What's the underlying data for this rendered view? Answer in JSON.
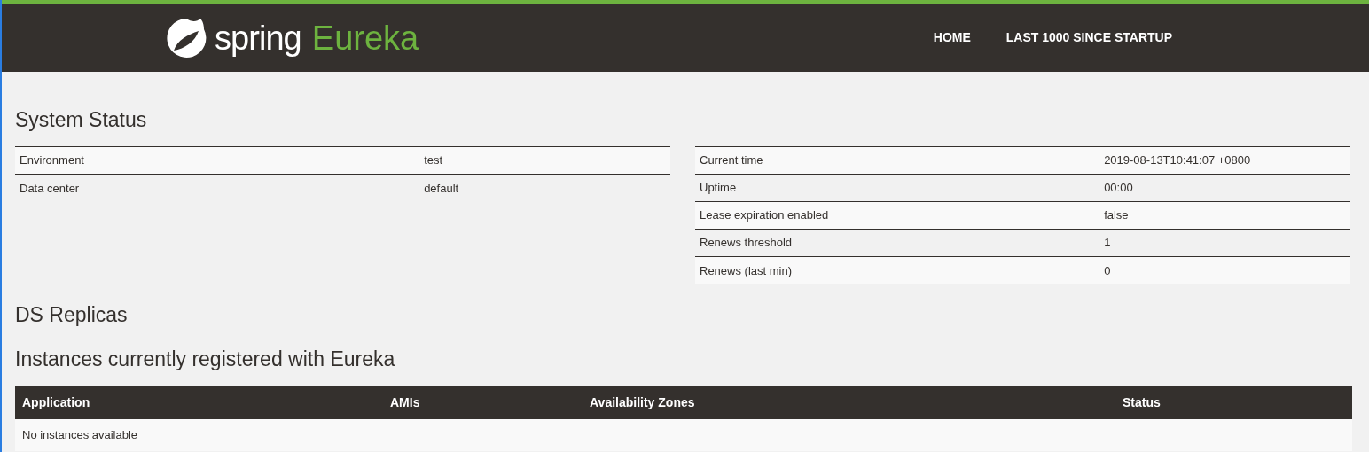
{
  "header": {
    "logo": {
      "word": "spring",
      "product": "Eureka"
    },
    "nav": [
      {
        "label": "HOME"
      },
      {
        "label": "LAST 1000 SINCE STARTUP"
      }
    ]
  },
  "system_status": {
    "title": "System Status",
    "left_table": [
      {
        "name": "Environment",
        "value": "test"
      },
      {
        "name": "Data center",
        "value": "default"
      }
    ],
    "right_table": [
      {
        "name": "Current time",
        "value": "2019-08-13T10:41:07 +0800"
      },
      {
        "name": "Uptime",
        "value": "00:00"
      },
      {
        "name": "Lease expiration enabled",
        "value": "false"
      },
      {
        "name": "Renews threshold",
        "value": "1"
      },
      {
        "name": "Renews (last min)",
        "value": "0"
      }
    ]
  },
  "ds_replicas": {
    "title": "DS Replicas"
  },
  "instances": {
    "title": "Instances currently registered with Eureka",
    "columns": [
      "Application",
      "AMIs",
      "Availability Zones",
      "Status"
    ],
    "empty_message": "No instances available"
  }
}
